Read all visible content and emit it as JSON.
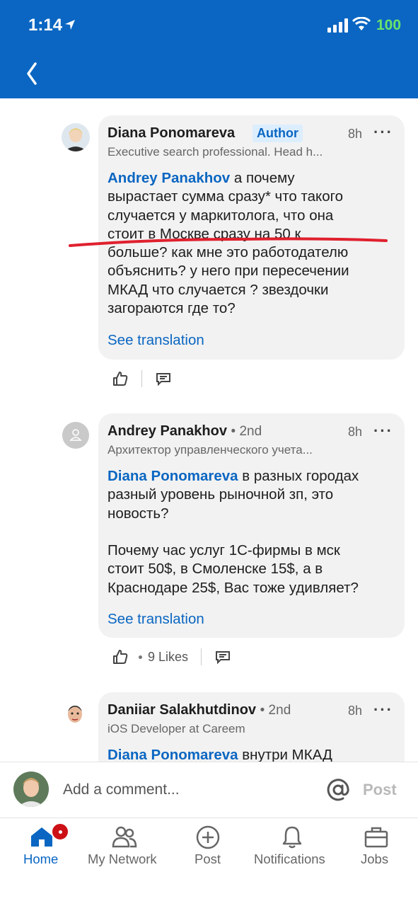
{
  "status_bar": {
    "time": "1:14",
    "battery": "100"
  },
  "comments": [
    {
      "name": "Diana Ponomareva",
      "badge": "Author",
      "time": "8h",
      "headline": "Executive search professional. Head h...",
      "mention": "Andrey Panakhov",
      "text_line1": " а почему",
      "text_rest": "вырастает сумма сразу* что такого\nслучается у маркитолога, что она\nстоит в Москве сразу на 50 к\nбольше? как мне это работодателю\nобъяснить? у него при пересечении\nМКАД что случается ? звездочки\nзагораются где то?",
      "see_translation": "See translation"
    },
    {
      "name": "Andrey Panakhov",
      "degree": "• 2nd",
      "time": "8h",
      "headline": "Архитектор управленческого учета...",
      "mention": "Diana Ponomareva",
      "text_line1": " в разных городах",
      "text_rest": "разный уровень рыночной зп, это\nновость?\n\nПочему час услуг 1С-фирмы в мск\nстоит 50$, в Смоленске 15$, а в\nКраснодаре 25$, Вас тоже удивляет?",
      "see_translation": "See translation",
      "likes": "9 Likes"
    },
    {
      "name": "Daniiar Salakhutdinov",
      "degree": "• 2nd",
      "time": "8h",
      "headline": "iOS Developer at Careem",
      "mention": "Diana Ponomareva",
      "text_line1": " внутри МКАД"
    }
  ],
  "comment_bar": {
    "placeholder": "Add a comment...",
    "post_label": "Post"
  },
  "tabs": [
    {
      "label": "Home",
      "icon": "home-icon",
      "active": true
    },
    {
      "label": "My Network",
      "icon": "network-icon"
    },
    {
      "label": "Post",
      "icon": "plus-icon"
    },
    {
      "label": "Notifications",
      "icon": "bell-icon"
    },
    {
      "label": "Jobs",
      "icon": "briefcase-icon"
    }
  ],
  "colors": {
    "brand": "#0a66c2",
    "annotation": "#e0202e"
  }
}
